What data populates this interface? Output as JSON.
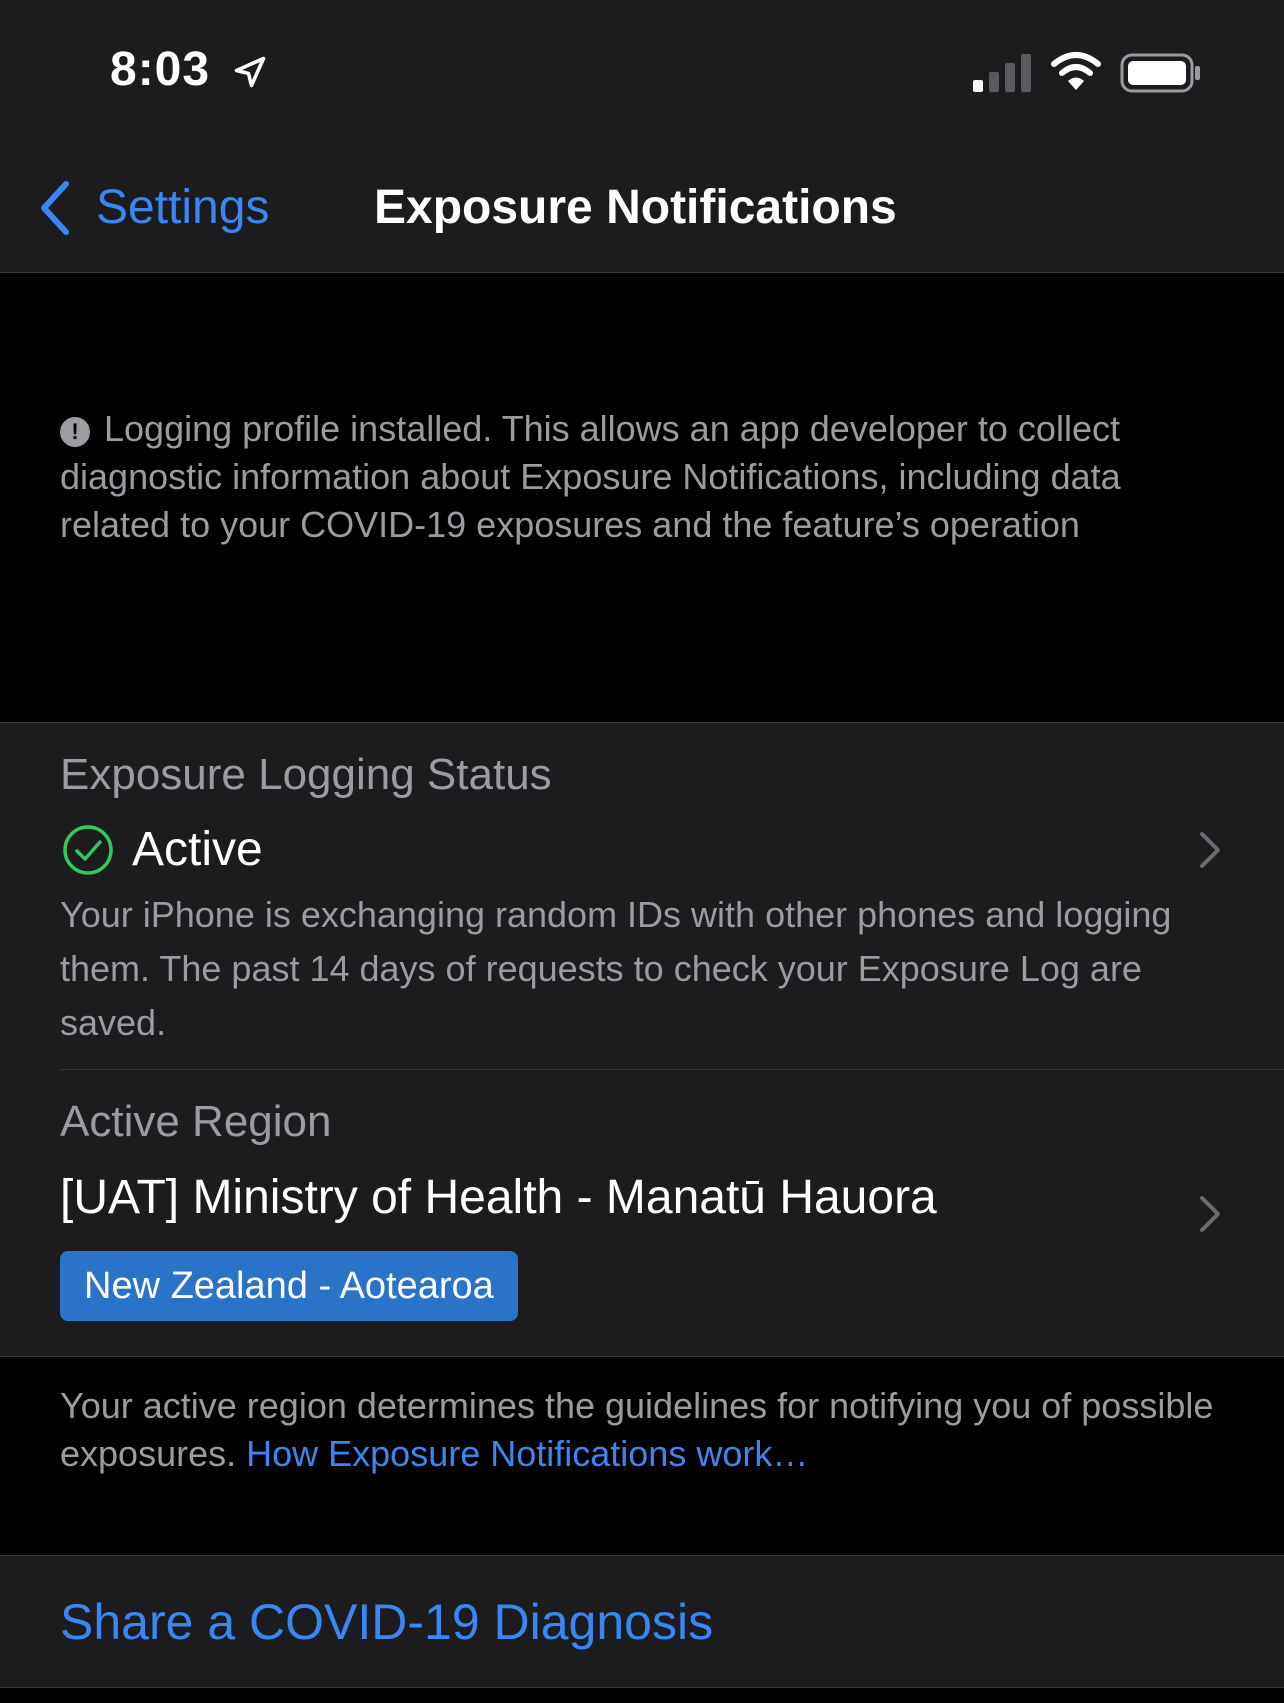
{
  "status_bar": {
    "time": "8:03",
    "icons": [
      "location-arrow-icon",
      "cellular-signal-icon",
      "wifi-icon",
      "battery-icon"
    ]
  },
  "nav": {
    "back_label": "Settings",
    "title": "Exposure Notifications"
  },
  "info_banner": {
    "icon": "exclamation-circle-icon",
    "text": "Logging profile installed. This allows an app developer to collect diagnostic information about Exposure Notifications, including data related to your COVID-19 exposures and the feature’s operation"
  },
  "logging_status": {
    "label": "Exposure Logging Status",
    "value": "Active",
    "icon": "checkmark-circle-icon",
    "description": "Your iPhone is exchanging random IDs with other phones and logging them. The past 14 days of requests to check your Exposure Log are saved."
  },
  "active_region": {
    "label": "Active Region",
    "value": "[UAT] Ministry of Health - Manatū Hauora",
    "badge": "New Zealand - Aotearoa"
  },
  "footer": {
    "text": "Your active region determines the guidelines for notifying you of possible exposures.",
    "link": "How Exposure Notifications work…"
  },
  "share": {
    "label": "Share a COVID-19 Diagnosis"
  },
  "colors": {
    "accent": "#3a86f3",
    "success": "#34c759",
    "badge": "#2b73c8",
    "card": "#1c1c1e",
    "secondary_text": "#9b9ba1"
  }
}
